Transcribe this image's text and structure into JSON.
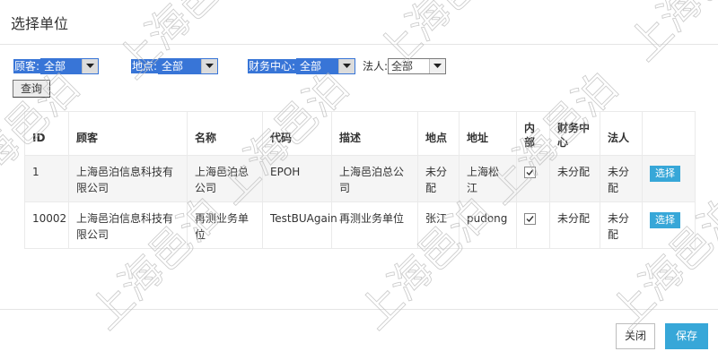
{
  "dialog": {
    "title": "选择单位"
  },
  "filters": {
    "customer": {
      "label": "顾客:",
      "value": "全部"
    },
    "location": {
      "label": "地点:",
      "value": "全部"
    },
    "finance_center": {
      "label": "财务中心:",
      "value": "全部"
    },
    "legal_person": {
      "label": "法人:",
      "value": "全部"
    }
  },
  "query_button": "查询",
  "table": {
    "columns": [
      "ID",
      "顾客",
      "名称",
      "代码",
      "描述",
      "地点",
      "地址",
      "内部",
      "财务中心",
      "法人",
      ""
    ],
    "rows": [
      {
        "id": "1",
        "customer": "上海邑泊信息科技有限公司",
        "name": "上海邑泊总公司",
        "code": "EPOH",
        "description": "上海邑泊总公司",
        "location": "未分配",
        "address": "上海松江",
        "internal": true,
        "finance_center": "未分配",
        "legal_person": "未分配",
        "action": "选择"
      },
      {
        "id": "10002",
        "customer": "上海邑泊信息科技有限公司",
        "name": "再测业务单位",
        "code": "TestBUAgain",
        "description": "再测业务单位",
        "location": "张江",
        "address": "pudong",
        "internal": true,
        "finance_center": "未分配",
        "legal_person": "未分配",
        "action": "选择"
      }
    ]
  },
  "footer": {
    "close_label": "关闭",
    "save_label": "保存"
  },
  "watermark": {
    "text": "上海邑泊"
  },
  "colors": {
    "accent": "#37a7d8",
    "selection": "#3875d7"
  }
}
